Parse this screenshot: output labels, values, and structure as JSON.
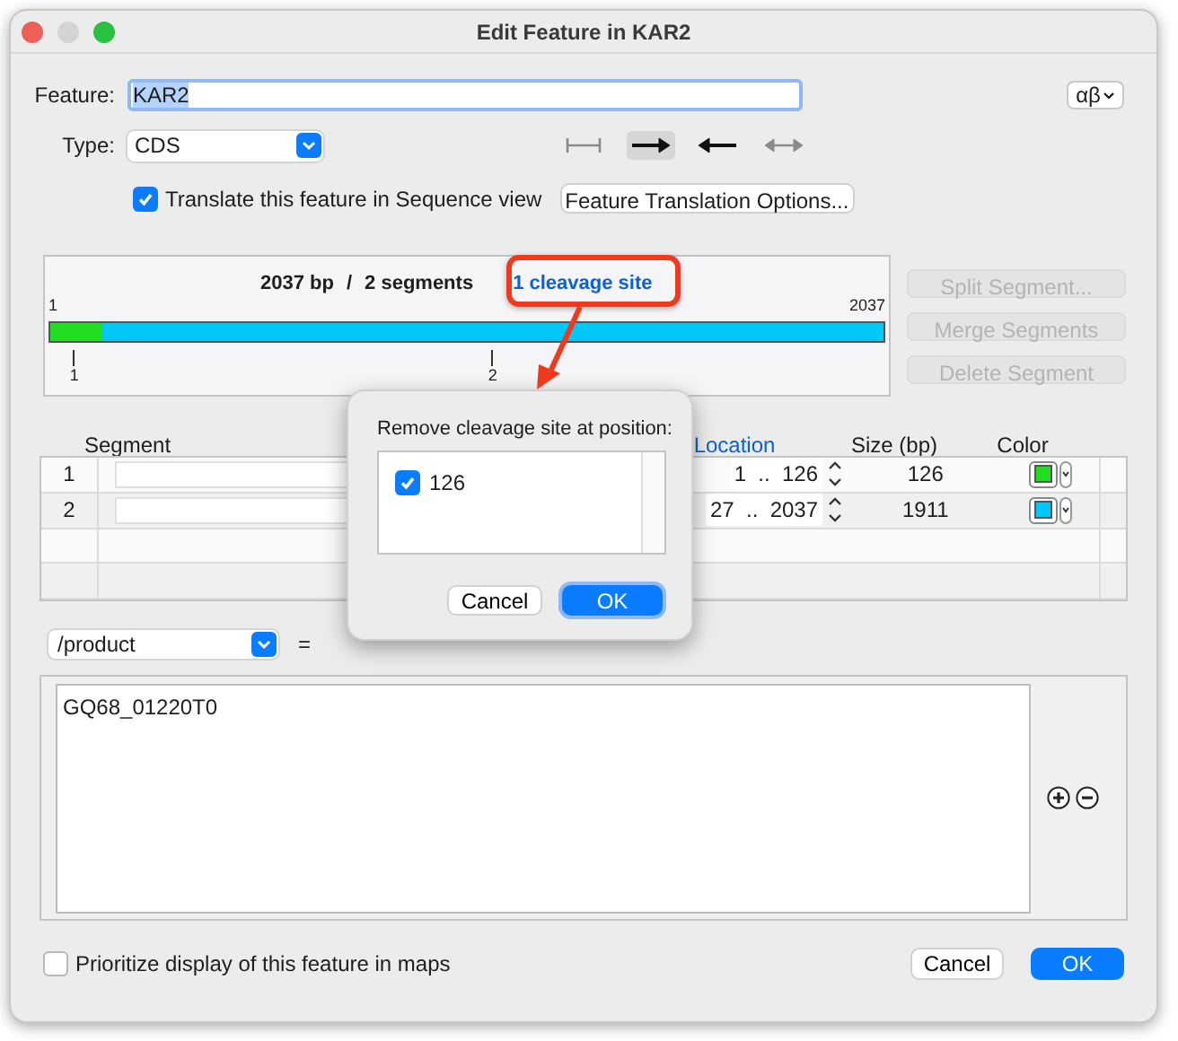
{
  "window": {
    "title": "Edit Feature in KAR2"
  },
  "feature": {
    "label": "Feature:",
    "value": "KAR2",
    "charset_button": "αβ"
  },
  "type": {
    "label": "Type:",
    "value": "CDS"
  },
  "directions": [
    {
      "kind": "none",
      "selected": false
    },
    {
      "kind": "forward",
      "selected": true
    },
    {
      "kind": "reverse",
      "selected": false
    },
    {
      "kind": "both",
      "selected": false
    }
  ],
  "translate": {
    "label": "Translate this feature in Sequence view",
    "checked": true
  },
  "translation_options_button": "Feature Translation Options...",
  "segment_map": {
    "length": "2037 bp",
    "separator": "/",
    "segments": "2 segments",
    "cleavage_link": "1 cleavage site",
    "start": "1",
    "end": "2037",
    "bar": [
      {
        "label": "1",
        "level": 0.062,
        "color": "#22dd22"
      },
      {
        "label": "2",
        "level": 0.938,
        "color": "#00c8f8"
      }
    ]
  },
  "segment_buttons": [
    {
      "label": "Split Segment...",
      "disabled": true
    },
    {
      "label": "Merge Segments",
      "disabled": true
    },
    {
      "label": "Delete Segment",
      "disabled": true
    }
  ],
  "table": {
    "columns": [
      {
        "label": "Segment",
        "sorted": false
      },
      {
        "label": "Location",
        "sorted": true
      },
      {
        "label": "Size (bp)",
        "sorted": false
      },
      {
        "label": "Color",
        "sorted": false
      }
    ],
    "rows": [
      {
        "number": "1",
        "location": "1  ..  126",
        "size": "126",
        "color": "#22dd22"
      },
      {
        "number": "2",
        "location": "27  ..  2037",
        "size": "1911",
        "color": "#00c8f8"
      }
    ]
  },
  "qualifier": {
    "name": "/product",
    "equals": "=",
    "value": "GQ68_01220T0"
  },
  "prioritize": {
    "label": "Prioritize display of this feature in maps",
    "checked": false
  },
  "buttons": [
    {
      "label": "Cancel",
      "kind": "secondary"
    },
    {
      "label": "OK",
      "kind": "primary"
    }
  ],
  "popover": {
    "title": "Remove cleavage site at position:",
    "items": [
      {
        "label": "126",
        "checked": true
      }
    ],
    "buttons": [
      {
        "label": "Cancel",
        "kind": "secondary"
      },
      {
        "label": "OK",
        "kind": "primary"
      }
    ]
  }
}
